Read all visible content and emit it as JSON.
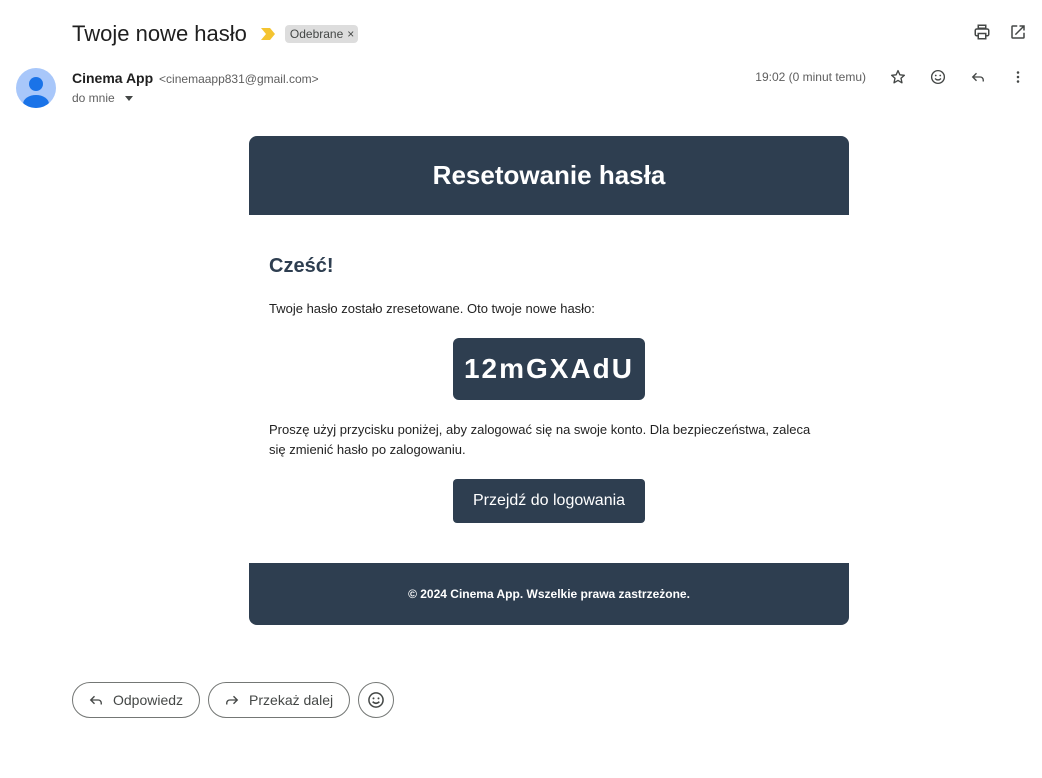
{
  "subject": "Twoje nowe hasło",
  "label_chip": {
    "text": "Odebrane",
    "close": "×"
  },
  "sender": {
    "name": "Cinema App",
    "email": "<cinemaapp831@gmail.com>",
    "to": "do mnie"
  },
  "timestamp": "19:02 (0 minut temu)",
  "email": {
    "header_title": "Resetowanie hasła",
    "greeting": "Cześć!",
    "intro": "Twoje hasło zostało zresetowane. Oto twoje nowe hasło:",
    "password": "12mGXAdU",
    "instructions": "Proszę użyj przycisku poniżej, aby zalogować się na swoje konto. Dla bezpieczeństwa, zaleca się zmienić hasło po zalogowaniu.",
    "button_label": "Przejdź do logowania",
    "footer": "© 2024 Cinema App. Wszelkie prawa zastrzeżone."
  },
  "actions": {
    "reply": "Odpowiedz",
    "forward": "Przekaż dalej"
  },
  "colors": {
    "brand_dark": "#2e3e50",
    "importance_marker": "#f4c430",
    "avatar_bg": "#a8c7fa",
    "avatar_fg": "#1a73e8"
  },
  "icons": {
    "importance": "importance-marker-icon",
    "print": "print-icon",
    "open_new_window": "open-in-new-window-icon",
    "star": "star-icon",
    "emoji": "emoji-reaction-icon",
    "reply": "reply-icon",
    "more": "more-vertical-icon",
    "forward": "forward-icon"
  }
}
